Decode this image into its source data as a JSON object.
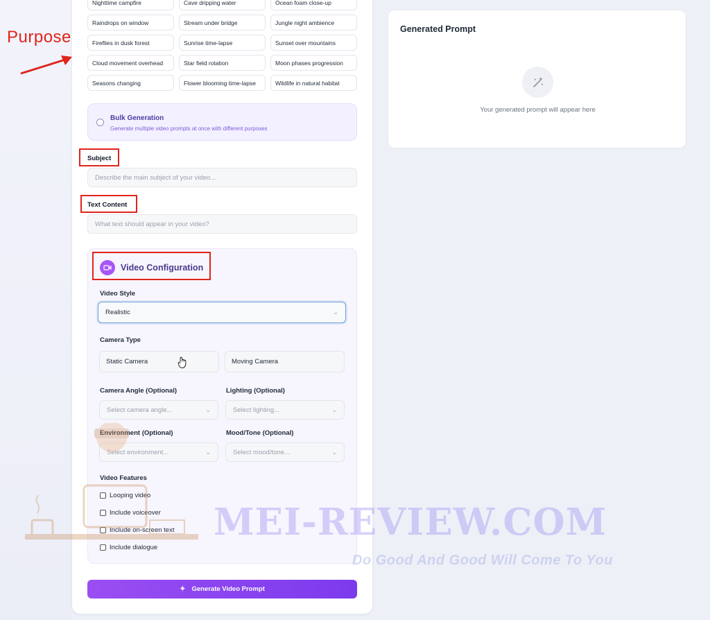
{
  "annotation": {
    "purpose_label": "Purpose"
  },
  "purpose_options": [
    "Nighttime campfire",
    "Cave dripping water",
    "Ocean foam close-up",
    "Raindrops on window",
    "Stream under bridge",
    "Jungle night ambience",
    "Fireflies in dusk forest",
    "Sunrise time-lapse",
    "Sunset over mountains",
    "Cloud movement overhead",
    "Star field rotation",
    "Moon phases progression",
    "Seasons changing",
    "Flower blooming time-lapse",
    "Wildlife in natural habitat"
  ],
  "bulk": {
    "title": "Bulk Generation",
    "description": "Generate multiple video prompts at once with different purposes"
  },
  "subject": {
    "label": "Subject",
    "placeholder": "Describe the main subject of your video..."
  },
  "text_content": {
    "label": "Text Content",
    "placeholder": "What text should appear in your video?"
  },
  "video_config": {
    "title": "Video Configuration",
    "icon": "video-camera-icon",
    "style_label": "Video Style",
    "style_value": "Realistic",
    "camera_type_label": "Camera Type",
    "camera_types": [
      "Static Camera",
      "Moving Camera"
    ],
    "camera_angle_label": "Camera Angle (Optional)",
    "camera_angle_placeholder": "Select camera angle...",
    "lighting_label": "Lighting (Optional)",
    "lighting_placeholder": "Select lighting...",
    "environment_label": "Environment (Optional)",
    "environment_placeholder": "Select environment...",
    "mood_label": "Mood/Tone (Optional)",
    "mood_placeholder": "Select mood/tone...",
    "features_label": "Video Features",
    "features": [
      "Looping video",
      "Include voiceover",
      "Include on-screen text",
      "Include dialogue"
    ]
  },
  "generate_button": "Generate Video Prompt",
  "output": {
    "title": "Generated Prompt",
    "placeholder": "Your generated prompt will appear here",
    "icon": "magic-wand-icon"
  },
  "watermark": {
    "text": "MEI-REVIEW.COM",
    "tagline": "Do Good And Good Will Come To You"
  },
  "colors": {
    "accent": "#7c3aed",
    "annotation": "#e0241b"
  }
}
